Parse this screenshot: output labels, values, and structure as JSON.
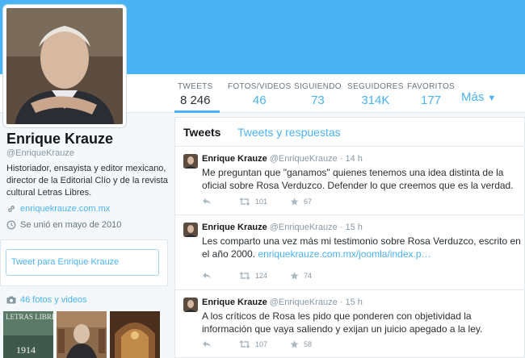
{
  "profile": {
    "name": "Enrique Krauze",
    "handle": "@EnriqueKrauze",
    "bio": "Historiador, ensayista y editor mexicano, director de la Editorial Clío y de la revista cultural Letras Libres.",
    "website": "enriquekrauze.com.mx",
    "joined": "Se unió en mayo de 2010"
  },
  "stats": [
    {
      "label": "TWEETS",
      "value": "8 246"
    },
    {
      "label": "FOTOS/VIDEOS",
      "value": "46"
    },
    {
      "label": "SIGUIENDO",
      "value": "73"
    },
    {
      "label": "SEGUIDORES",
      "value": "314K"
    },
    {
      "label": "FAVORITOS",
      "value": "177"
    }
  ],
  "more_label": "Más",
  "tweet_to": {
    "placeholder": "Tweet para Enrique Krauze"
  },
  "photos": {
    "label": "46 fotos y videos",
    "thumb_text": [
      "LETRAS LIBRES",
      "1914"
    ]
  },
  "timeline_tabs": {
    "tweets": "Tweets",
    "replies": "Tweets y respuestas"
  },
  "tweets": [
    {
      "name": "Enrique Krauze",
      "handle": "@EnriqueKrauze",
      "dot": "·",
      "time": "14 h",
      "text": "Me preguntan que \"ganamos\" quienes tenemos una idea distinta de la oficial sobre Rosa Verduzco. Defender lo que creemos que es la verdad.",
      "link": "",
      "retweets": "101",
      "favorites": "67"
    },
    {
      "name": "Enrique Krauze",
      "handle": "@EnriqueKrauze",
      "dot": "·",
      "time": "15 h",
      "text": "Les comparto una vez más mi testimonio sobre Rosa Verduzco, escrito en el año 2000.",
      "link": "enriquekrauze.com.mx/joomla/index.p…",
      "retweets": "124",
      "favorites": "74"
    },
    {
      "name": "Enrique Krauze",
      "handle": "@EnriqueKrauze",
      "dot": "·",
      "time": "15 h",
      "text": "A los críticos de Rosa les pido que ponderen con objetividad la información que vaya saliendo y exijan un juicio apegado a la ley.",
      "link": "",
      "retweets": "107",
      "favorites": "58"
    }
  ],
  "colors": {
    "accent": "#4ab3f4",
    "banner": "#4ab3f4",
    "text": "#292f33",
    "muted": "#8899a6"
  }
}
